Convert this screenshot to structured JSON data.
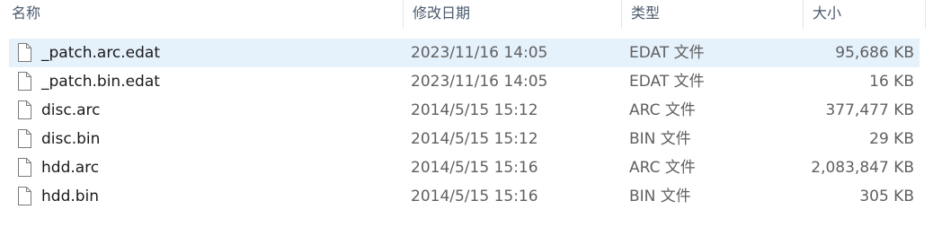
{
  "columns": {
    "name": "名称",
    "date": "修改日期",
    "type": "类型",
    "size": "大小"
  },
  "icons": {
    "file": "generic-file-icon"
  },
  "colors": {
    "selected_row": "#e5f1fb",
    "header_text": "#4a5a6e",
    "secondary_text": "#606060"
  },
  "files": [
    {
      "name": "_patch.arc.edat",
      "date": "2023/11/16 14:05",
      "type": "EDAT 文件",
      "size": "95,686 KB",
      "selected": true
    },
    {
      "name": "_patch.bin.edat",
      "date": "2023/11/16 14:05",
      "type": "EDAT 文件",
      "size": "16 KB",
      "selected": false
    },
    {
      "name": "disc.arc",
      "date": "2014/5/15 15:12",
      "type": "ARC 文件",
      "size": "377,477 KB",
      "selected": false
    },
    {
      "name": "disc.bin",
      "date": "2014/5/15 15:12",
      "type": "BIN 文件",
      "size": "29 KB",
      "selected": false
    },
    {
      "name": "hdd.arc",
      "date": "2014/5/15 15:16",
      "type": "ARC 文件",
      "size": "2,083,847 KB",
      "selected": false
    },
    {
      "name": "hdd.bin",
      "date": "2014/5/15 15:16",
      "type": "BIN 文件",
      "size": "305 KB",
      "selected": false
    }
  ]
}
